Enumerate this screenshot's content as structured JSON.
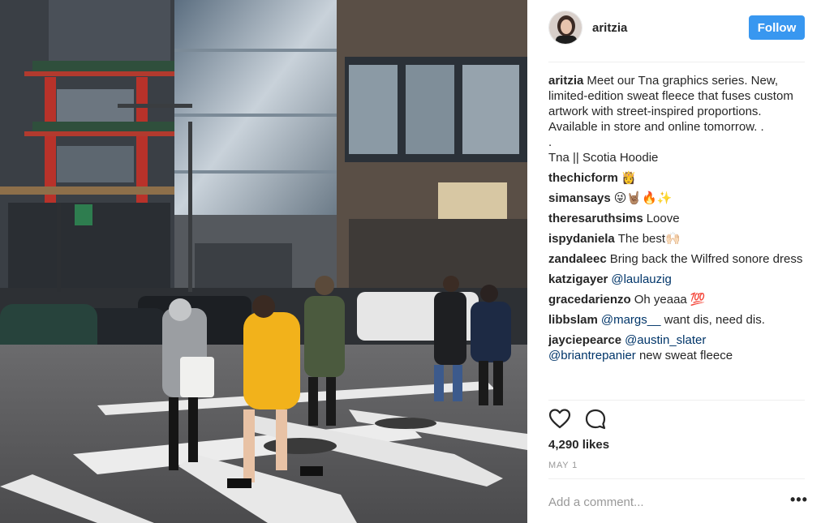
{
  "post": {
    "username": "aritzia",
    "follow_label": "Follow",
    "caption": "Meet our Tna graphics series. New, limited-edition sweat fleece that fuses custom artwork with street-inspired proportions. Available in store and online tomorrow. .\n.\nTna || Scotia Hoodie",
    "likes": "4,290 likes",
    "date": "MAY 1",
    "add_comment_placeholder": "Add a comment...",
    "more_label": "•••"
  },
  "comments": [
    {
      "user": "thechicform",
      "text": "👸"
    },
    {
      "user": "simansays",
      "text": "😜🤘🏽🔥✨"
    },
    {
      "user": "theresaruthsims",
      "text": "Loove"
    },
    {
      "user": "ispydaniela",
      "text": "The best🙌🏻"
    },
    {
      "user": "zandaleec",
      "text": "Bring back the Wilfred sonore dress"
    },
    {
      "user": "katzigayer",
      "mention": "@laulauzig",
      "text": ""
    },
    {
      "user": "gracedarienzo",
      "text": "Oh yeaaa 💯"
    },
    {
      "user": "libbslam",
      "mention": "@margs__",
      "text": "want dis, need dis."
    },
    {
      "user": "jayciepearce",
      "mention": "@austin_slater",
      "mention2": "@briantrepanier",
      "text": "new sweat fleece"
    }
  ],
  "icons": {
    "like": "heart-icon",
    "comment": "comment-bubble-icon"
  },
  "colors": {
    "follow_button": "#3897f0",
    "text": "#262626",
    "muted": "#999999",
    "mention": "#003569"
  }
}
